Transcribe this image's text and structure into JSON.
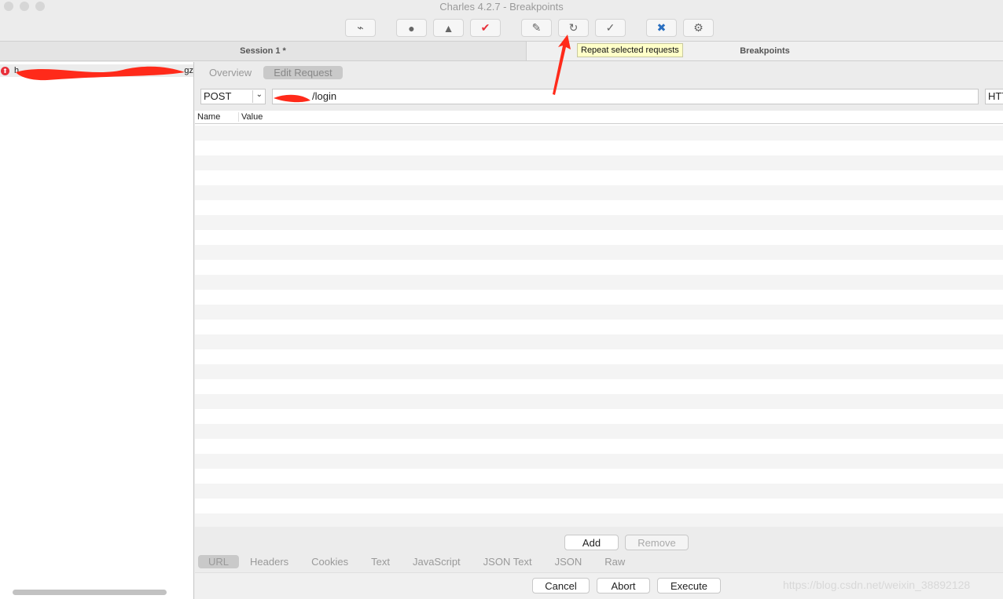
{
  "window": {
    "title": "Charles 4.2.7 - Breakpoints"
  },
  "toolbar": {
    "buttons": [
      {
        "name": "broom-icon",
        "glyph": "⌁"
      },
      {
        "name": "record-icon",
        "glyph": "●"
      },
      {
        "name": "throttle-turtle-icon",
        "glyph": "▲"
      },
      {
        "name": "breakpoint-icon",
        "glyph": "✔"
      },
      {
        "name": "compose-pen-icon",
        "glyph": "✎"
      },
      {
        "name": "repeat-icon",
        "glyph": "↻"
      },
      {
        "name": "validate-check-icon",
        "glyph": "✓"
      },
      {
        "name": "tools-icon",
        "glyph": "✖"
      },
      {
        "name": "settings-gear-icon",
        "glyph": "⚙"
      }
    ],
    "tooltip": "Repeat selected requests"
  },
  "headers": {
    "session": "Session 1 *",
    "breakpoints": "Breakpoints"
  },
  "left": {
    "row_text": "h",
    "row_suffix": "gz"
  },
  "tabs": {
    "overview": "Overview",
    "edit_request": "Edit Request"
  },
  "request": {
    "method": "POST",
    "url": "/login",
    "protocol": "HTT"
  },
  "table": {
    "col_name": "Name",
    "col_value": "Value"
  },
  "actions": {
    "add": "Add",
    "remove": "Remove",
    "cancel": "Cancel",
    "abort": "Abort",
    "execute": "Execute"
  },
  "bottom_tabs": [
    "URL",
    "Headers",
    "Cookies",
    "Text",
    "JavaScript",
    "JSON Text",
    "JSON",
    "Raw"
  ],
  "watermark": "https://blog.csdn.net/weixin_38892128",
  "colors": {
    "annotation": "#ff2a1a"
  }
}
